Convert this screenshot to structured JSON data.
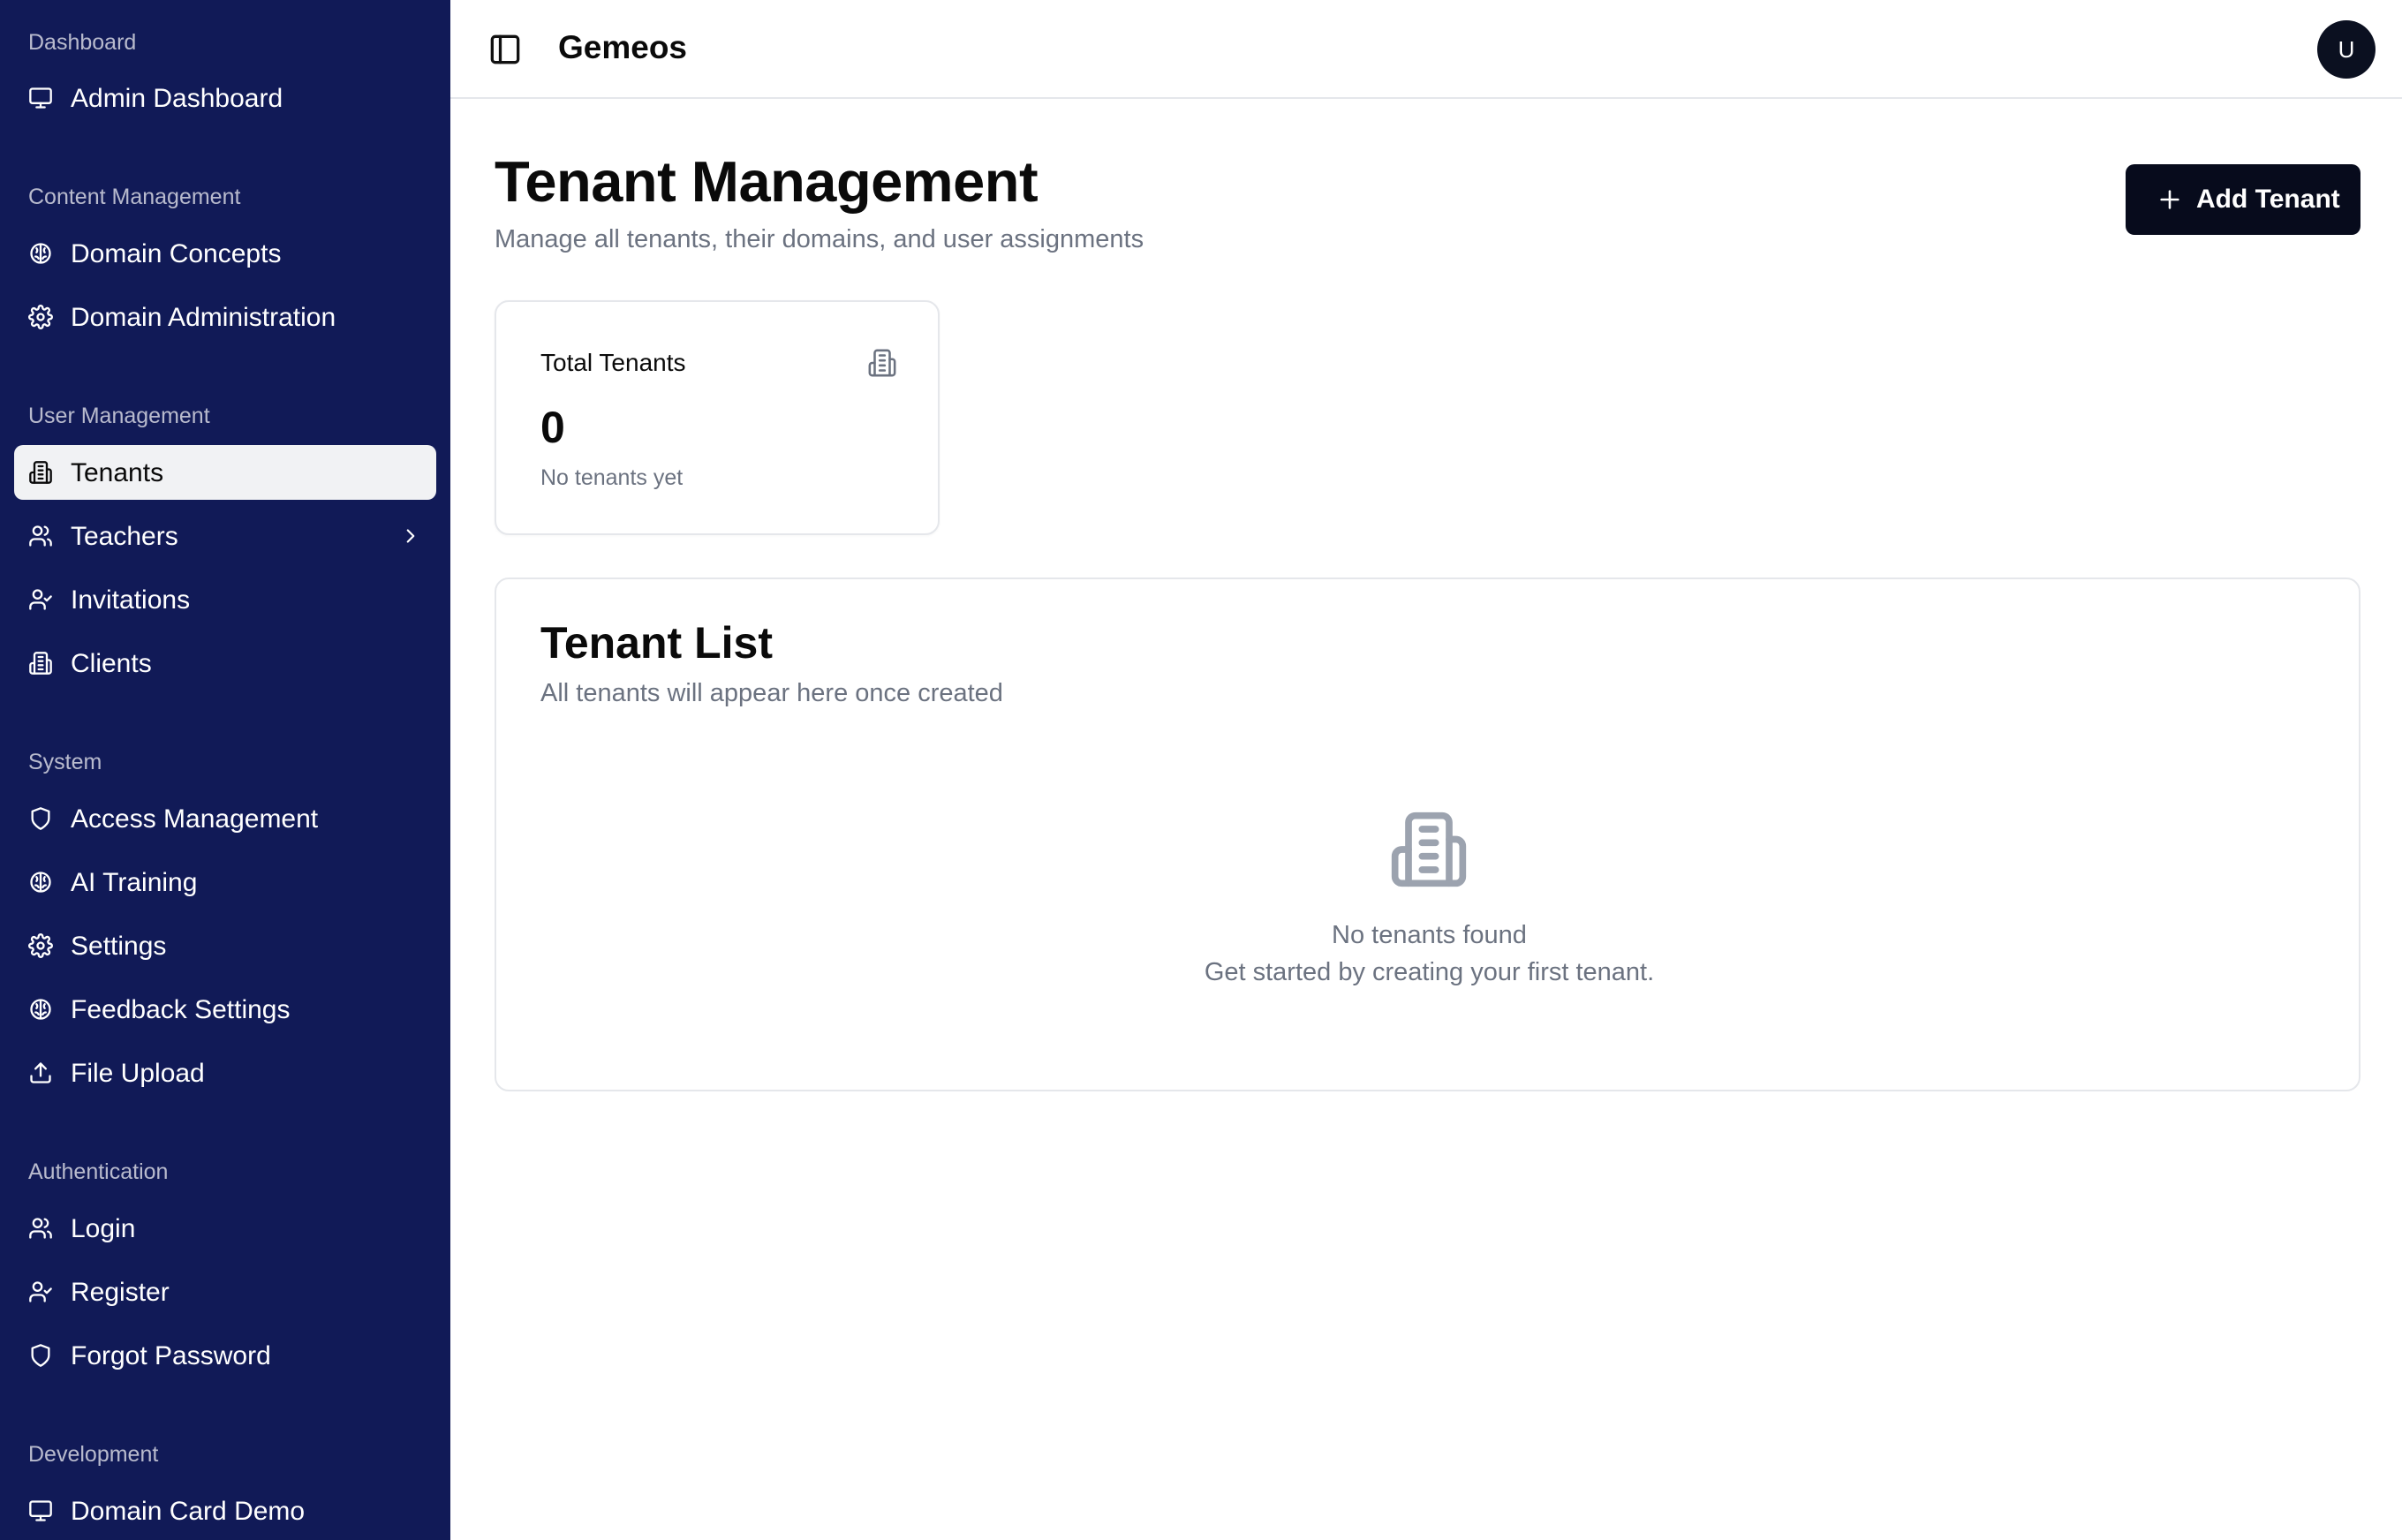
{
  "app": {
    "brand": "Gemeos",
    "user_initial": "U"
  },
  "sidebar": {
    "groups": [
      {
        "label": "Dashboard",
        "items": [
          {
            "label": "Admin Dashboard",
            "icon": "monitor-icon"
          }
        ]
      },
      {
        "label": "Content Management",
        "items": [
          {
            "label": "Domain Concepts",
            "icon": "brain-icon"
          },
          {
            "label": "Domain Administration",
            "icon": "gear-icon"
          }
        ]
      },
      {
        "label": "User Management",
        "items": [
          {
            "label": "Tenants",
            "icon": "building-icon",
            "active": true
          },
          {
            "label": "Teachers",
            "icon": "users-icon",
            "has_submenu": true
          },
          {
            "label": "Invitations",
            "icon": "user-check-icon"
          },
          {
            "label": "Clients",
            "icon": "building-icon"
          }
        ]
      },
      {
        "label": "System",
        "items": [
          {
            "label": "Access Management",
            "icon": "shield-icon"
          },
          {
            "label": "AI Training",
            "icon": "brain-icon"
          },
          {
            "label": "Settings",
            "icon": "gear-icon"
          },
          {
            "label": "Feedback Settings",
            "icon": "brain-icon"
          },
          {
            "label": "File Upload",
            "icon": "upload-icon"
          }
        ]
      },
      {
        "label": "Authentication",
        "items": [
          {
            "label": "Login",
            "icon": "users-icon"
          },
          {
            "label": "Register",
            "icon": "user-check-icon"
          },
          {
            "label": "Forgot Password",
            "icon": "shield-icon"
          }
        ]
      },
      {
        "label": "Development",
        "items": [
          {
            "label": "Domain Card Demo",
            "icon": "monitor-icon"
          }
        ]
      }
    ]
  },
  "main": {
    "title": "Tenant Management",
    "subtitle": "Manage all tenants, their domains, and user assignments",
    "add_button_label": "Add Tenant",
    "stats": {
      "title": "Total Tenants",
      "value": "0",
      "note": "No tenants yet"
    },
    "list": {
      "title": "Tenant List",
      "subtitle": "All tenants will appear here once created",
      "empty_title": "No tenants found",
      "empty_description": "Get started by creating your first tenant."
    }
  },
  "colors": {
    "sidebar_bg": "#111a57",
    "primary_button": "#070b1c",
    "active_item_bg": "#f1f2f4"
  }
}
